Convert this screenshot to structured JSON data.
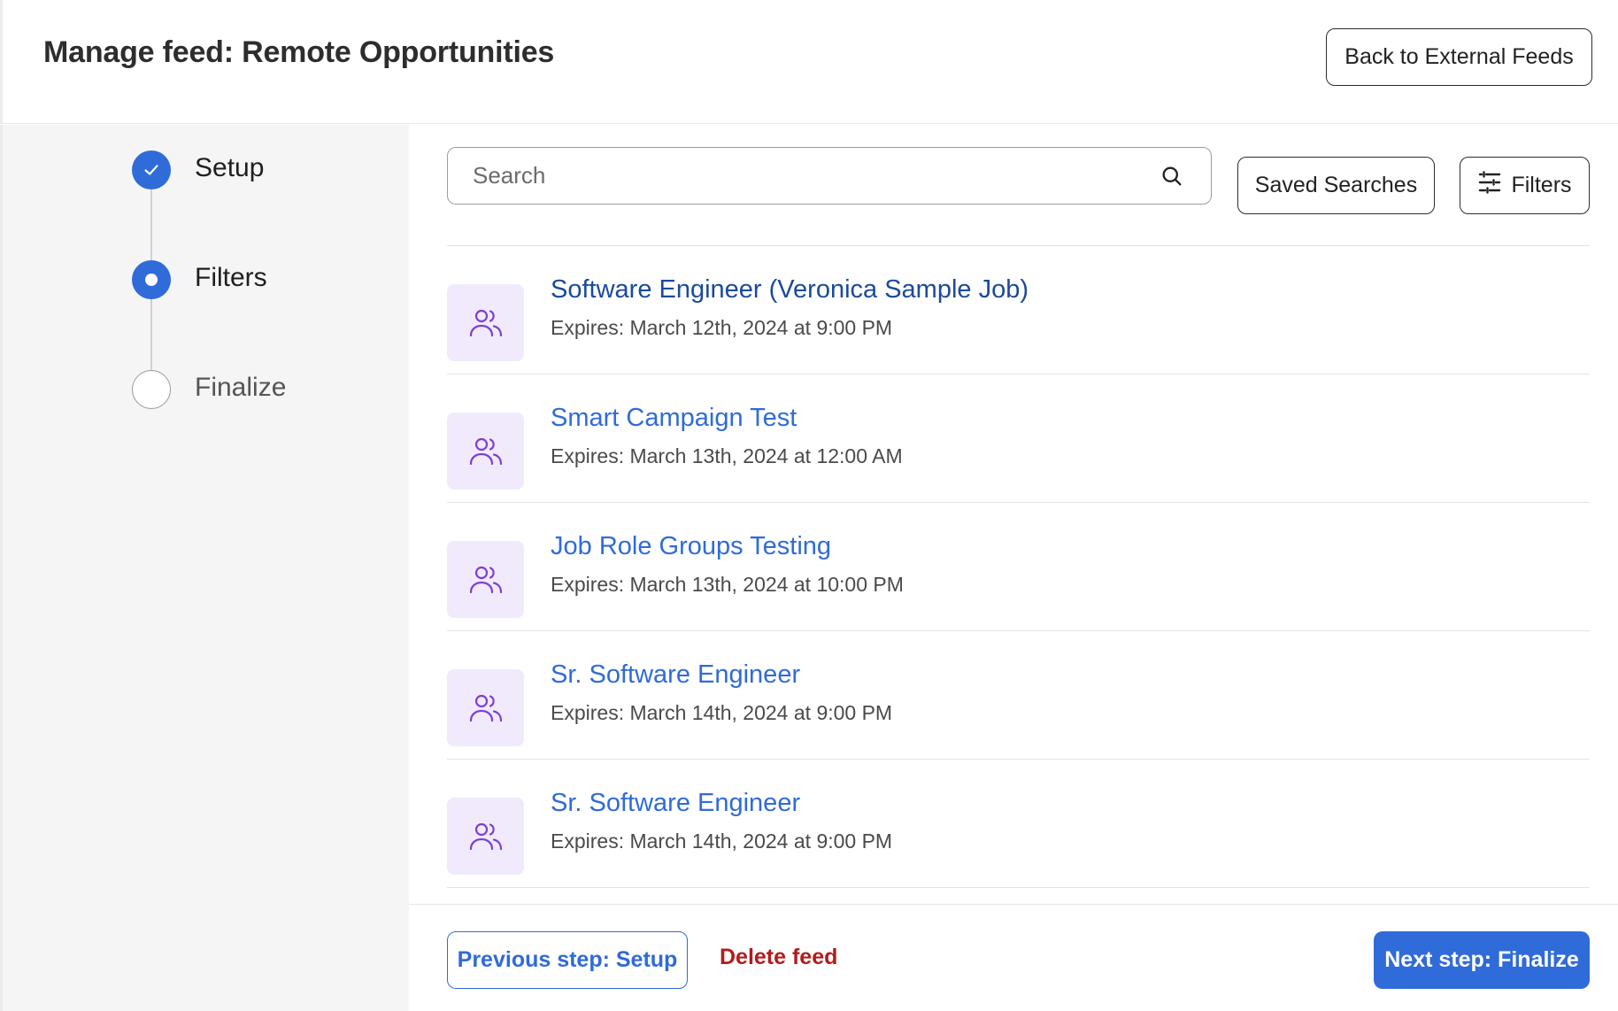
{
  "header": {
    "title": "Manage feed: Remote Opportunities",
    "back_label": "Back to External Feeds"
  },
  "steps": [
    {
      "label": "Setup",
      "state": "done"
    },
    {
      "label": "Filters",
      "state": "current"
    },
    {
      "label": "Finalize",
      "state": "todo"
    }
  ],
  "toolbar": {
    "search_placeholder": "Search",
    "search_value": "",
    "search_icon": "search-icon",
    "saved_searches_label": "Saved Searches",
    "filters_label": "Filters",
    "filters_icon": "sliders-icon"
  },
  "jobs": [
    {
      "title": "Software Engineer (Veronica Sample Job)",
      "expires": "Expires: March 12th, 2024 at 9:00 PM",
      "icon": "users-icon"
    },
    {
      "title": "Smart Campaign Test",
      "expires": "Expires: March 13th, 2024 at 12:00 AM",
      "icon": "users-icon"
    },
    {
      "title": "Job Role Groups Testing",
      "expires": "Expires: March 13th, 2024 at 10:00 PM",
      "icon": "users-icon"
    },
    {
      "title": "Sr. Software Engineer",
      "expires": "Expires: March 14th, 2024 at 9:00 PM",
      "icon": "users-icon"
    },
    {
      "title": "Sr. Software Engineer",
      "expires": "Expires: March 14th, 2024 at 9:00 PM",
      "icon": "users-icon"
    }
  ],
  "footer": {
    "prev_label": "Previous step: Setup",
    "delete_label": "Delete feed",
    "next_label": "Next step: Finalize"
  },
  "colors": {
    "accent": "#2f6bd9",
    "danger": "#b01c1c",
    "icon_tile": "#f1eafc",
    "icon_stroke": "#7a3fd6"
  }
}
